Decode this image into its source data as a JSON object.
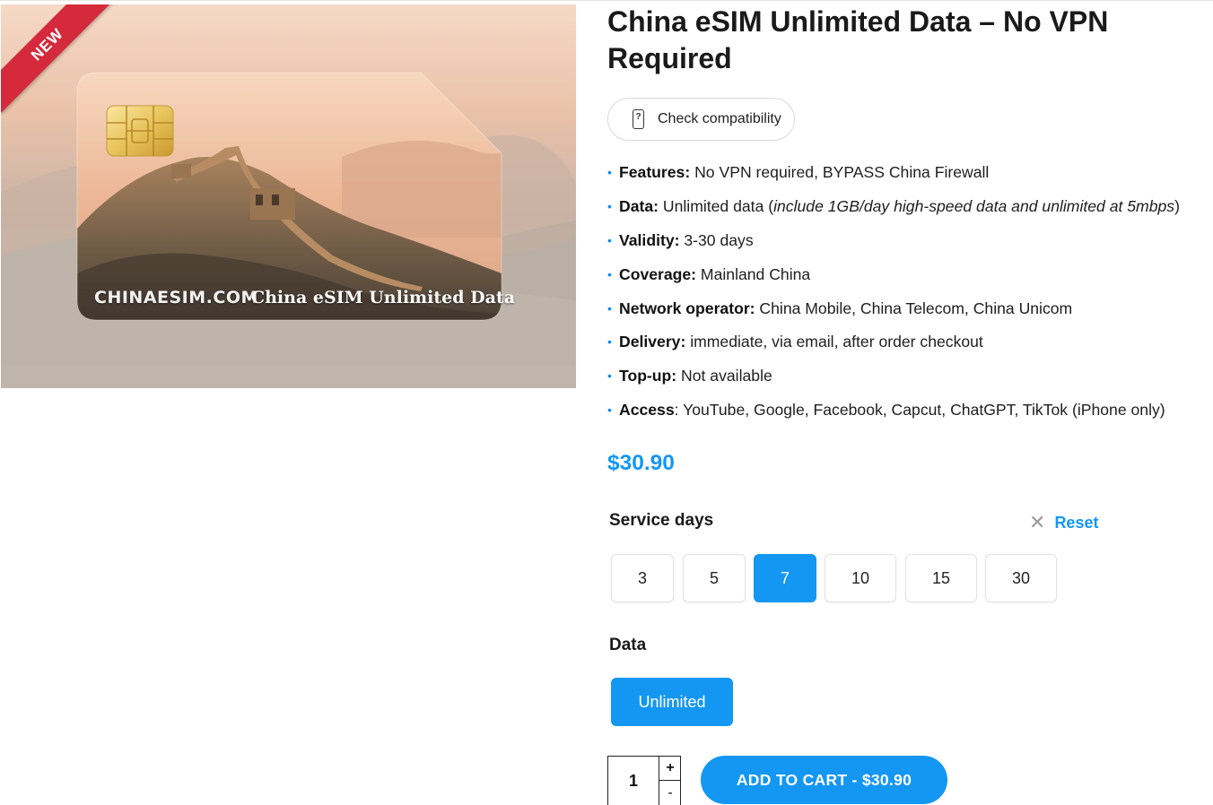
{
  "product": {
    "badge": "NEW",
    "image": {
      "logo_text": "CHINAESIM.COM",
      "card_title": "China eSIM Unlimited Data"
    },
    "title": "China eSIM Unlimited Data – No VPN Required",
    "compat_button": {
      "label": "Check compatibility",
      "icon": "phone-question-icon"
    },
    "features": [
      {
        "label": "Features:",
        "text": " No VPN required, BYPASS China Firewall"
      },
      {
        "label": "Data:",
        "text": " Unlimited data (",
        "italic": "include 1GB/day high-speed data and unlimited at 5mbps",
        "after": ")"
      },
      {
        "label": "Validity:",
        "text": " 3-30 days"
      },
      {
        "label": "Coverage:",
        "text": " Mainland China"
      },
      {
        "label": "Network operator:",
        "text": " China Mobile, China Telecom, China Unicom"
      },
      {
        "label": "Delivery:",
        "text": " immediate, via email, after order checkout"
      },
      {
        "label": "Top-up:",
        "text": " Not available"
      },
      {
        "label": "Access",
        "text": ": YouTube, Google, Facebook, Capcut, ChatGPT, TikTok (iPhone only)"
      }
    ],
    "price": "$30.90",
    "service_days": {
      "label": "Service days",
      "reset_label": "Reset",
      "options": [
        "3",
        "5",
        "7",
        "10",
        "15",
        "30"
      ],
      "selected": "7"
    },
    "data": {
      "label": "Data",
      "options": [
        "Unlimited"
      ],
      "selected": "Unlimited"
    },
    "quantity": {
      "value": "1",
      "plus": "+",
      "minus": "-"
    },
    "add_to_cart": "ADD TO CART - $30.90"
  },
  "colors": {
    "accent": "#1497f2",
    "badge": "#d42a3c",
    "bullet": "#1a8ce8"
  }
}
